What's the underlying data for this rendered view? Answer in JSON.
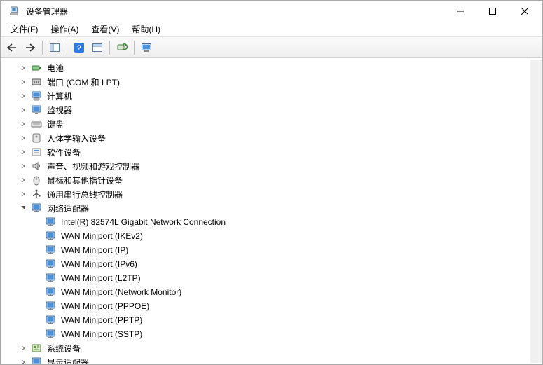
{
  "window": {
    "title": "设备管理器"
  },
  "menu": {
    "file": "文件(F)",
    "actions": "操作(A)",
    "view": "查看(V)",
    "help": "帮助(H)"
  },
  "categories": [
    {
      "id": "battery",
      "label": "电池",
      "icon": "battery",
      "expanded": false
    },
    {
      "id": "ports",
      "label": "端口 (COM 和 LPT)",
      "icon": "port",
      "expanded": false
    },
    {
      "id": "computer",
      "label": "计算机",
      "icon": "computer",
      "expanded": false
    },
    {
      "id": "monitors",
      "label": "监视器",
      "icon": "monitor",
      "expanded": false
    },
    {
      "id": "keyboards",
      "label": "键盘",
      "icon": "keyboard",
      "expanded": false
    },
    {
      "id": "hid",
      "label": "人体学输入设备",
      "icon": "hid",
      "expanded": false
    },
    {
      "id": "software",
      "label": "软件设备",
      "icon": "software",
      "expanded": false
    },
    {
      "id": "sound",
      "label": "声音、视频和游戏控制器",
      "icon": "sound",
      "expanded": false
    },
    {
      "id": "mouse",
      "label": "鼠标和其他指针设备",
      "icon": "mouse",
      "expanded": false
    },
    {
      "id": "usb",
      "label": "通用串行总线控制器",
      "icon": "usb",
      "expanded": false
    },
    {
      "id": "network",
      "label": "网络适配器",
      "icon": "network",
      "expanded": true,
      "children": [
        {
          "label": "Intel(R) 82574L Gigabit Network Connection",
          "icon": "network"
        },
        {
          "label": "WAN Miniport (IKEv2)",
          "icon": "network"
        },
        {
          "label": "WAN Miniport (IP)",
          "icon": "network"
        },
        {
          "label": "WAN Miniport (IPv6)",
          "icon": "network"
        },
        {
          "label": "WAN Miniport (L2TP)",
          "icon": "network"
        },
        {
          "label": "WAN Miniport (Network Monitor)",
          "icon": "network"
        },
        {
          "label": "WAN Miniport (PPPOE)",
          "icon": "network"
        },
        {
          "label": "WAN Miniport (PPTP)",
          "icon": "network"
        },
        {
          "label": "WAN Miniport (SSTP)",
          "icon": "network"
        }
      ]
    },
    {
      "id": "system",
      "label": "系统设备",
      "icon": "system",
      "expanded": false
    },
    {
      "id": "display",
      "label": "显示适配器",
      "icon": "display",
      "expanded": false
    }
  ]
}
